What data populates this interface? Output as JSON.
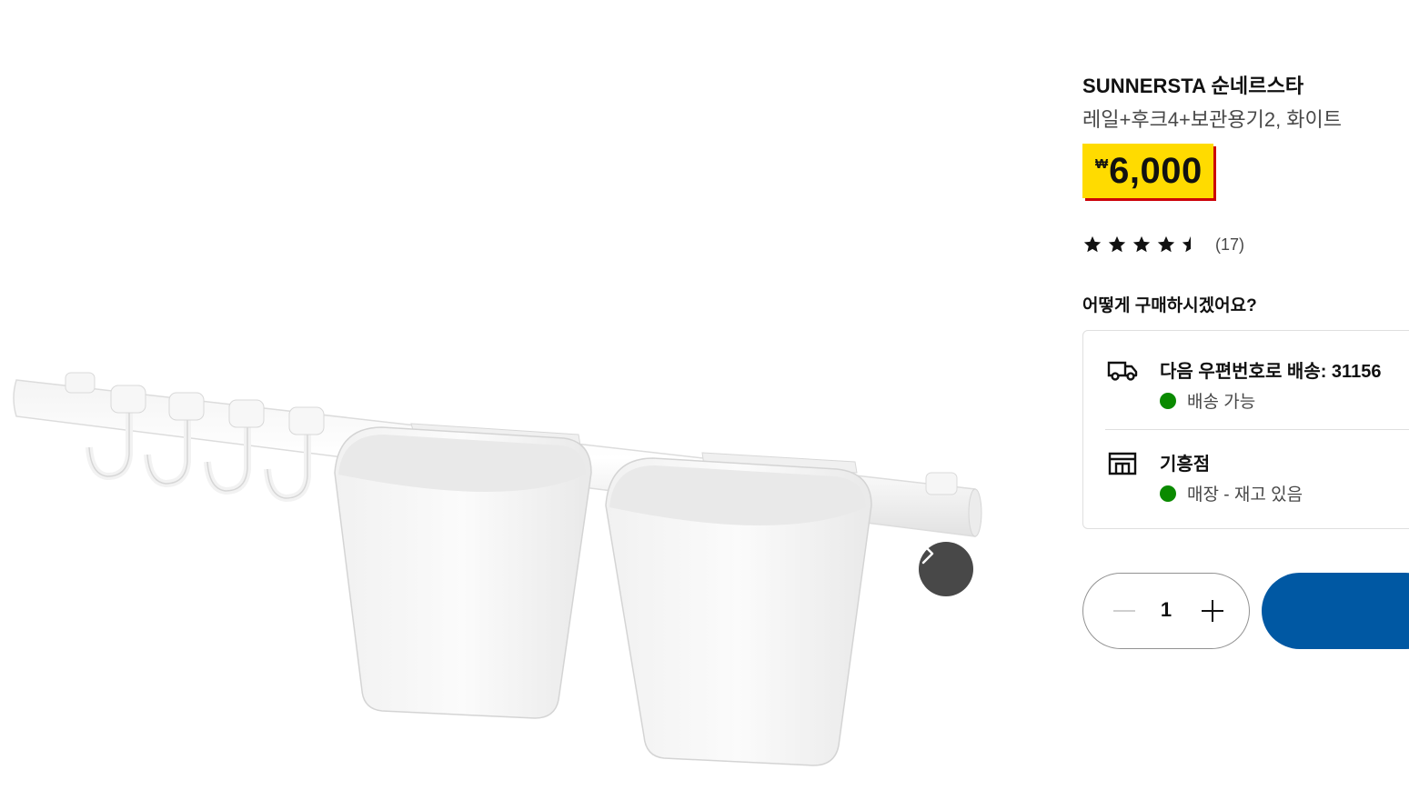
{
  "product": {
    "name": "SUNNERSTA 순네르스타",
    "description": "레일+후크4+보관용기2, 화이트",
    "price": {
      "currency_symbol": "₩",
      "amount": "6,000",
      "highlight_color": "#ffdb00",
      "accent_color": "#cc0008"
    },
    "rating": {
      "stars": 4.5,
      "max_stars": 5,
      "count_label": "(17)"
    }
  },
  "gallery": {
    "next_icon": "chevron-right-icon"
  },
  "purchase": {
    "question": "어떻게 구매하시겠어요?",
    "delivery": {
      "icon": "truck-icon",
      "title": "다음 우편번호로 배송: 31156",
      "status": "배송 가능",
      "status_color": "#0a8a00"
    },
    "store": {
      "icon": "store-icon",
      "title": "기흥점",
      "status": "매장 - 재고 있음",
      "status_color": "#0a8a00"
    }
  },
  "quantity": {
    "value": "1",
    "minus_icon": "minus-icon",
    "plus_icon": "plus-icon"
  },
  "cart_button": {
    "color": "#0058a3"
  }
}
